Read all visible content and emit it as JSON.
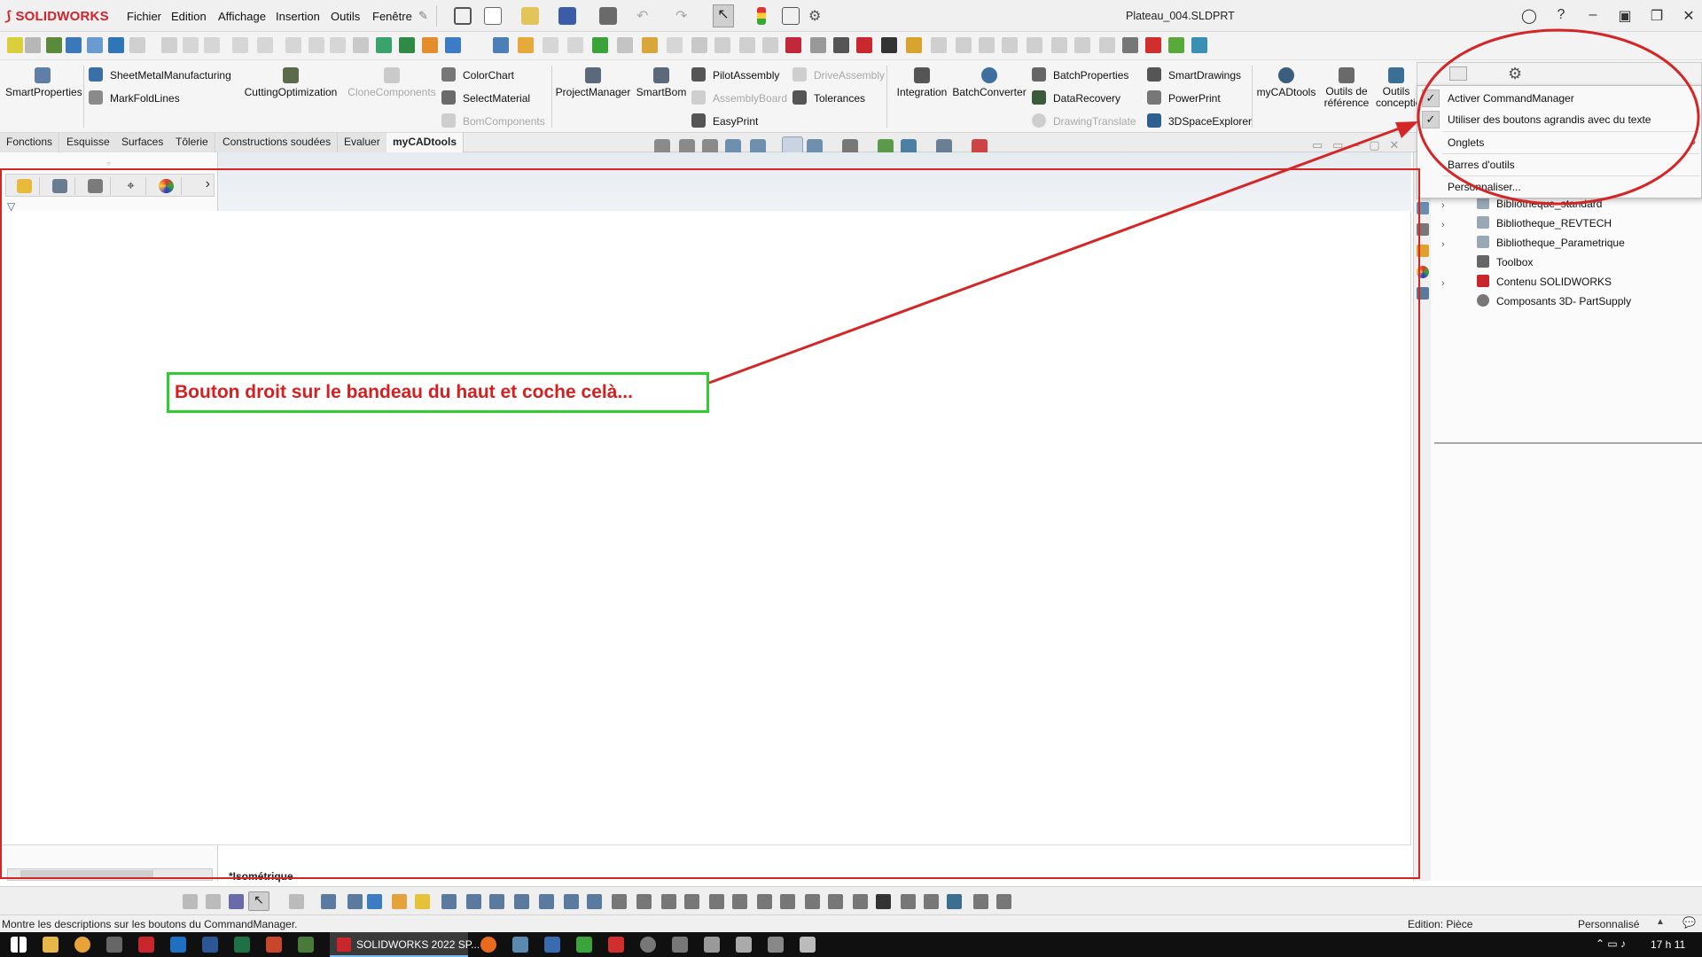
{
  "app": {
    "logo": "SOLIDWORKS",
    "logo_prefix": "DS",
    "document_title": "Plateau_004.SLDPRT"
  },
  "menu": [
    "Fichier",
    "Edition",
    "Affichage",
    "Insertion",
    "Outils",
    "Fenêtre"
  ],
  "command_manager": {
    "big_buttons": [
      {
        "label": "SmartProperties",
        "disabled": false
      },
      {
        "label": "CuttingOptimization",
        "disabled": false
      },
      {
        "label": "CloneComponents",
        "disabled": true
      },
      {
        "label": "ProjectManager",
        "disabled": false
      },
      {
        "label": "SmartBom",
        "disabled": false
      },
      {
        "label": "Integration",
        "disabled": false
      },
      {
        "label": "BatchConverter",
        "disabled": false
      },
      {
        "label": "myCADtools",
        "disabled": false
      }
    ],
    "small_buttons": [
      {
        "label": "SheetMetalManufacturing",
        "disabled": false
      },
      {
        "label": "MarkFoldLines",
        "disabled": false
      },
      {
        "label": "ColorChart",
        "disabled": false
      },
      {
        "label": "SelectMaterial",
        "disabled": false
      },
      {
        "label": "BomComponents",
        "disabled": true
      },
      {
        "label": "PilotAssembly",
        "disabled": false
      },
      {
        "label": "AssemblyBoard",
        "disabled": true
      },
      {
        "label": "EasyPrint",
        "disabled": false
      },
      {
        "label": "DriveAssembly",
        "disabled": true
      },
      {
        "label": "Tolerances",
        "disabled": false
      },
      {
        "label": "BatchProperties",
        "disabled": false
      },
      {
        "label": "DataRecovery",
        "disabled": false
      },
      {
        "label": "DrawingTranslate",
        "disabled": true
      },
      {
        "label": "SmartDrawings",
        "disabled": false
      },
      {
        "label": "PowerPrint",
        "disabled": false
      },
      {
        "label": "3DSpaceExplorer",
        "disabled": false
      }
    ],
    "ref_tools": "Outils de référence",
    "concept_tools": "Outils conceptio"
  },
  "tabs": [
    "Fonctions",
    "Esquisse",
    "Surfaces",
    "Tôlerie",
    "Constructions soudées",
    "Evaluer",
    "myCADtools"
  ],
  "active_tab": "myCADtools",
  "context_menu": [
    {
      "label": "Activer CommandManager",
      "checked": true,
      "submenu": false
    },
    {
      "label": "Utiliser des boutons agrandis avec du texte",
      "checked": true,
      "submenu": false
    },
    {
      "label": "Onglets",
      "checked": false,
      "submenu": true
    },
    {
      "label": "Barres d'outils",
      "checked": false,
      "submenu": false
    },
    {
      "label": "Personnaliser...",
      "checked": false,
      "submenu": false
    }
  ],
  "design_library": [
    {
      "label": "Bibliotheque_standard",
      "expandable": true
    },
    {
      "label": "Bibliotheque_REVTECH",
      "expandable": true
    },
    {
      "label": "Bibliotheque_Parametrique",
      "expandable": true
    },
    {
      "label": "Toolbox",
      "expandable": false
    },
    {
      "label": "Contenu SOLIDWORKS",
      "expandable": true
    },
    {
      "label": "Composants 3D- PartSupply",
      "expandable": false
    }
  ],
  "viewport": {
    "view_label": "*Isométrique"
  },
  "annotation": {
    "text": "Bouton droit sur le bandeau du haut et coche celà..."
  },
  "status": {
    "left": "Montre les descriptions sur les boutons du CommandManager.",
    "mode": "Edition: Pièce",
    "units": "Personnalisé"
  },
  "taskbar": {
    "active_app": "SOLIDWORKS 2022 SP...",
    "clock": "17 h 11"
  },
  "colors": {
    "brand_red": "#d2232a",
    "annotation_red": "#d42626",
    "callout_green": "#2fce2f"
  }
}
